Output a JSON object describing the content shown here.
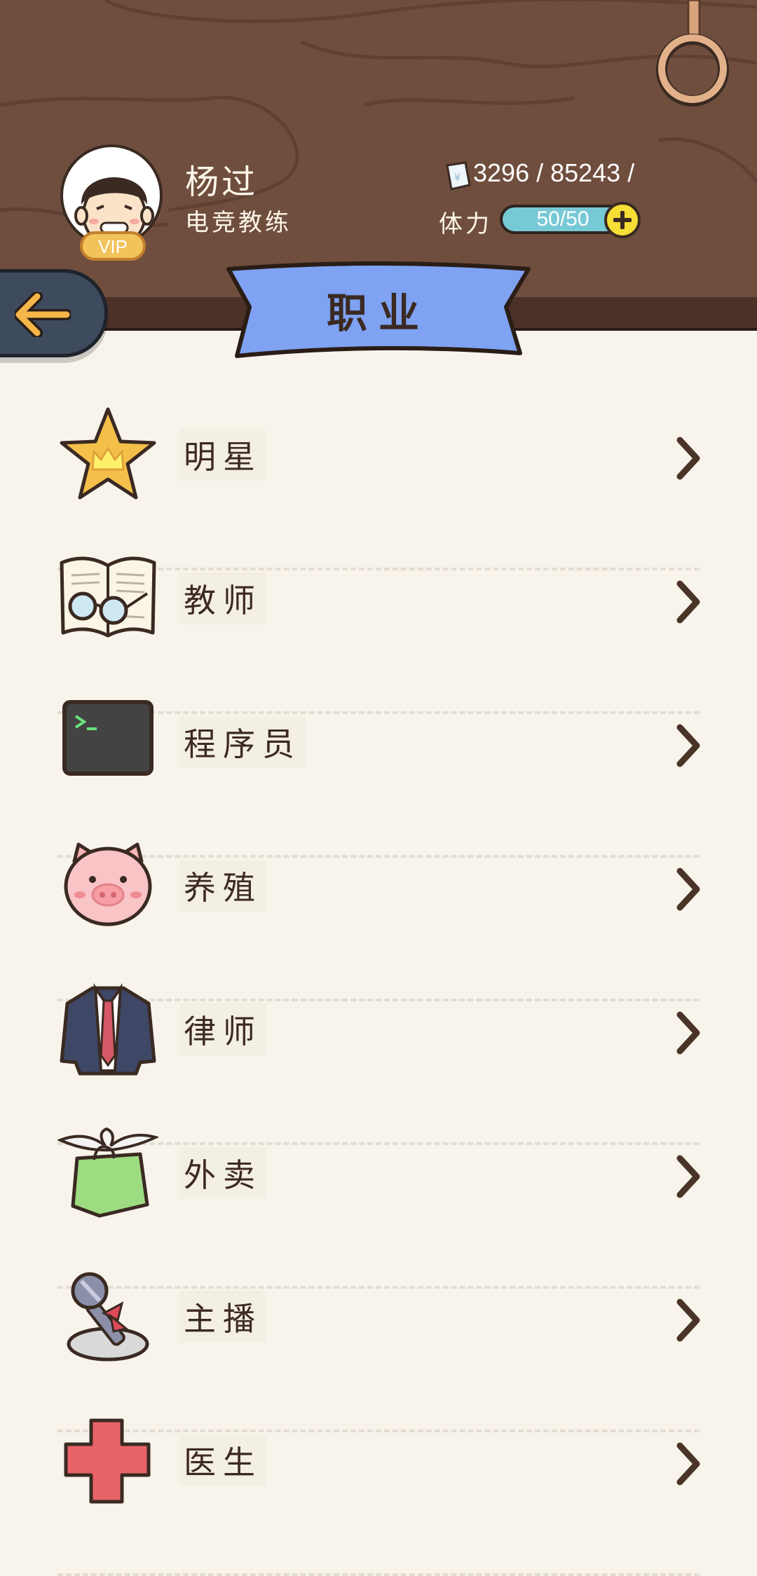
{
  "header": {
    "user_name": "杨过",
    "user_title": "电竞教练",
    "vip_label": "VIP",
    "money": "3296 / 85243 /",
    "stamina_label": "体力",
    "stamina_text": "50/50",
    "stamina_fraction": 1.0
  },
  "page_title": "职业",
  "careers": [
    {
      "label": "明星",
      "icon": "star-crown-icon"
    },
    {
      "label": "教师",
      "icon": "book-glasses-icon"
    },
    {
      "label": "程序员",
      "icon": "terminal-icon"
    },
    {
      "label": "养殖",
      "icon": "pig-icon"
    },
    {
      "label": "律师",
      "icon": "suit-icon"
    },
    {
      "label": "外卖",
      "icon": "delivery-bag-icon"
    },
    {
      "label": "主播",
      "icon": "microphone-icon"
    },
    {
      "label": "医生",
      "icon": "medical-cross-icon"
    }
  ],
  "colors": {
    "wood": "#6f4e3e",
    "band": "#4b3128",
    "ribbon": "#7fa2f2",
    "background": "#f8f4eb",
    "stamina_fill": "#78c9d6",
    "accent_yellow": "#f7de37"
  }
}
